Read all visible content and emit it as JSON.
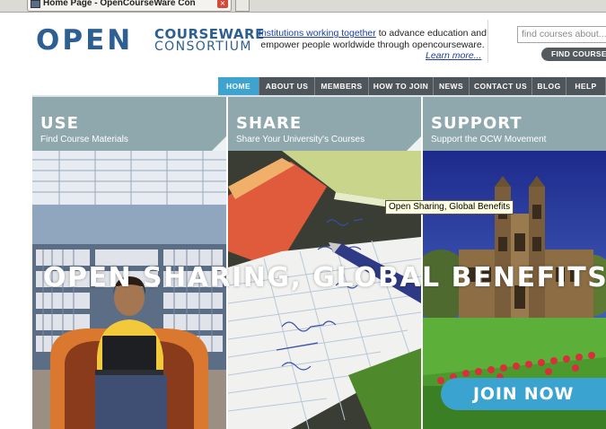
{
  "browser": {
    "tab_title": "Home Page - OpenCourseWare Con",
    "tab_close_glyph": "×"
  },
  "logo": {
    "open": "OPEN",
    "courseware": "COURSEWARE",
    "consortium": "CONSORTIUM"
  },
  "tagline": {
    "link": "Institutions working together",
    "rest_line1": " to advance education and",
    "line2": "empower people worldwide through opencourseware.",
    "learn_more": "Learn more..."
  },
  "search": {
    "placeholder": "find courses about...",
    "button_label": "FIND COURSES"
  },
  "nav": {
    "items": [
      "HOME",
      "ABOUT US",
      "MEMBERS",
      "HOW TO JOIN",
      "NEWS",
      "CONTACT US",
      "BLOG",
      "HELP"
    ],
    "active": "HOME"
  },
  "panels": [
    {
      "title": "USE",
      "subtitle": "Find Course Materials"
    },
    {
      "title": "SHARE",
      "subtitle": "Share Your University's Courses"
    },
    {
      "title": "SUPPORT",
      "subtitle": "Support the OCW Movement"
    }
  ],
  "headline": "OPEN SHARING, GLOBAL BENEFITS",
  "tooltip": "Open Sharing, Global Benefits",
  "join_button": "JOIN NOW",
  "colors": {
    "brand_blue": "#2d5f93",
    "nav_active": "#3ea3cf",
    "nav_bg": "#4e555b",
    "panel_header": "#8ea8ae",
    "join_button": "#3aa3cf"
  }
}
